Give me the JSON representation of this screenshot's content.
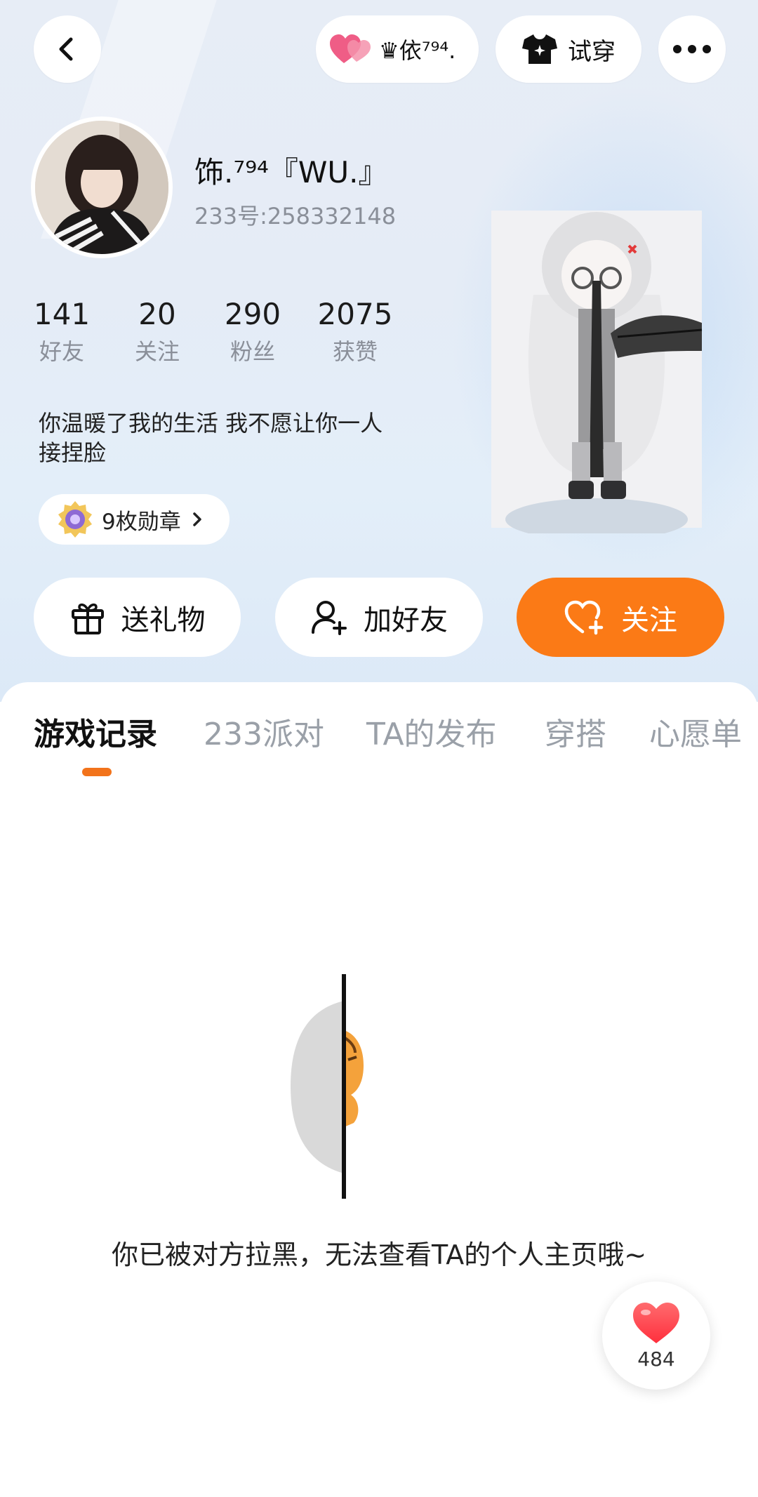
{
  "header": {
    "visitor_name": "♛依⁷⁹⁴.",
    "try_on_label": "试穿"
  },
  "profile": {
    "name": "饰.⁷⁹⁴『WU.』",
    "id_text": "233号:258332148",
    "bio_line1": "你温暖了我的生活 我不愿让你一人",
    "bio_line2": "接捏脸",
    "badges_label": "9枚勋章"
  },
  "stats": [
    {
      "value": "141",
      "label": "好友"
    },
    {
      "value": "20",
      "label": "关注"
    },
    {
      "value": "290",
      "label": "粉丝"
    },
    {
      "value": "2075",
      "label": "获赞"
    }
  ],
  "actions": {
    "gift_label": "送礼物",
    "add_friend_label": "加好友",
    "follow_label": "关注"
  },
  "tabs": [
    {
      "label": "游戏记录",
      "active": true
    },
    {
      "label": "233派对",
      "active": false
    },
    {
      "label": "TA的发布",
      "active": false
    },
    {
      "label": "穿搭",
      "active": false
    },
    {
      "label": "心愿单",
      "active": false
    }
  ],
  "blocked_message": "你已被对方拉黑，无法查看TA的个人主页哦~",
  "likes": {
    "count": "484"
  },
  "colors": {
    "accent": "#fb7a16",
    "tab_indicator": "#f2731b",
    "secondary_text": "#8a8f99",
    "inactive_tab": "#9aa0a8",
    "heart": "#ff4a52",
    "visitor_heart": "#ef5d86"
  },
  "icons": {
    "back": "chevron-left-icon",
    "visitor": "double-heart-icon",
    "try_on": "tshirt-icon",
    "more": "more-dots-icon",
    "gift": "gift-icon",
    "add_friend": "add-user-icon",
    "follow": "heart-plus-icon",
    "like": "heart-icon"
  }
}
